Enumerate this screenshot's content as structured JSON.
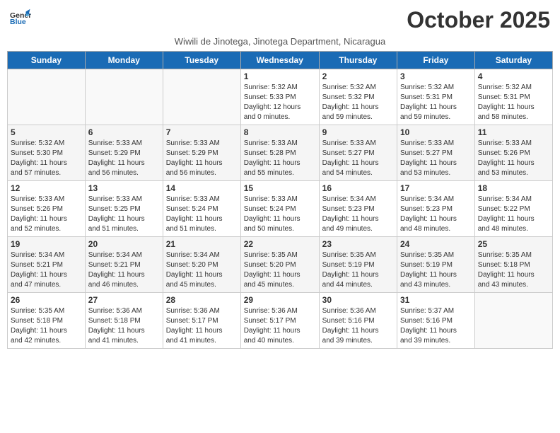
{
  "header": {
    "logo_general": "General",
    "logo_blue": "Blue",
    "month_title": "October 2025",
    "subtitle": "Wiwili de Jinotega, Jinotega Department, Nicaragua"
  },
  "weekdays": [
    "Sunday",
    "Monday",
    "Tuesday",
    "Wednesday",
    "Thursday",
    "Friday",
    "Saturday"
  ],
  "weeks": [
    [
      {
        "day": "",
        "info": ""
      },
      {
        "day": "",
        "info": ""
      },
      {
        "day": "",
        "info": ""
      },
      {
        "day": "1",
        "info": "Sunrise: 5:32 AM\nSunset: 5:33 PM\nDaylight: 12 hours\nand 0 minutes."
      },
      {
        "day": "2",
        "info": "Sunrise: 5:32 AM\nSunset: 5:32 PM\nDaylight: 11 hours\nand 59 minutes."
      },
      {
        "day": "3",
        "info": "Sunrise: 5:32 AM\nSunset: 5:31 PM\nDaylight: 11 hours\nand 59 minutes."
      },
      {
        "day": "4",
        "info": "Sunrise: 5:32 AM\nSunset: 5:31 PM\nDaylight: 11 hours\nand 58 minutes."
      }
    ],
    [
      {
        "day": "5",
        "info": "Sunrise: 5:32 AM\nSunset: 5:30 PM\nDaylight: 11 hours\nand 57 minutes."
      },
      {
        "day": "6",
        "info": "Sunrise: 5:33 AM\nSunset: 5:29 PM\nDaylight: 11 hours\nand 56 minutes."
      },
      {
        "day": "7",
        "info": "Sunrise: 5:33 AM\nSunset: 5:29 PM\nDaylight: 11 hours\nand 56 minutes."
      },
      {
        "day": "8",
        "info": "Sunrise: 5:33 AM\nSunset: 5:28 PM\nDaylight: 11 hours\nand 55 minutes."
      },
      {
        "day": "9",
        "info": "Sunrise: 5:33 AM\nSunset: 5:27 PM\nDaylight: 11 hours\nand 54 minutes."
      },
      {
        "day": "10",
        "info": "Sunrise: 5:33 AM\nSunset: 5:27 PM\nDaylight: 11 hours\nand 53 minutes."
      },
      {
        "day": "11",
        "info": "Sunrise: 5:33 AM\nSunset: 5:26 PM\nDaylight: 11 hours\nand 53 minutes."
      }
    ],
    [
      {
        "day": "12",
        "info": "Sunrise: 5:33 AM\nSunset: 5:26 PM\nDaylight: 11 hours\nand 52 minutes."
      },
      {
        "day": "13",
        "info": "Sunrise: 5:33 AM\nSunset: 5:25 PM\nDaylight: 11 hours\nand 51 minutes."
      },
      {
        "day": "14",
        "info": "Sunrise: 5:33 AM\nSunset: 5:24 PM\nDaylight: 11 hours\nand 51 minutes."
      },
      {
        "day": "15",
        "info": "Sunrise: 5:33 AM\nSunset: 5:24 PM\nDaylight: 11 hours\nand 50 minutes."
      },
      {
        "day": "16",
        "info": "Sunrise: 5:34 AM\nSunset: 5:23 PM\nDaylight: 11 hours\nand 49 minutes."
      },
      {
        "day": "17",
        "info": "Sunrise: 5:34 AM\nSunset: 5:23 PM\nDaylight: 11 hours\nand 48 minutes."
      },
      {
        "day": "18",
        "info": "Sunrise: 5:34 AM\nSunset: 5:22 PM\nDaylight: 11 hours\nand 48 minutes."
      }
    ],
    [
      {
        "day": "19",
        "info": "Sunrise: 5:34 AM\nSunset: 5:21 PM\nDaylight: 11 hours\nand 47 minutes."
      },
      {
        "day": "20",
        "info": "Sunrise: 5:34 AM\nSunset: 5:21 PM\nDaylight: 11 hours\nand 46 minutes."
      },
      {
        "day": "21",
        "info": "Sunrise: 5:34 AM\nSunset: 5:20 PM\nDaylight: 11 hours\nand 45 minutes."
      },
      {
        "day": "22",
        "info": "Sunrise: 5:35 AM\nSunset: 5:20 PM\nDaylight: 11 hours\nand 45 minutes."
      },
      {
        "day": "23",
        "info": "Sunrise: 5:35 AM\nSunset: 5:19 PM\nDaylight: 11 hours\nand 44 minutes."
      },
      {
        "day": "24",
        "info": "Sunrise: 5:35 AM\nSunset: 5:19 PM\nDaylight: 11 hours\nand 43 minutes."
      },
      {
        "day": "25",
        "info": "Sunrise: 5:35 AM\nSunset: 5:18 PM\nDaylight: 11 hours\nand 43 minutes."
      }
    ],
    [
      {
        "day": "26",
        "info": "Sunrise: 5:35 AM\nSunset: 5:18 PM\nDaylight: 11 hours\nand 42 minutes."
      },
      {
        "day": "27",
        "info": "Sunrise: 5:36 AM\nSunset: 5:18 PM\nDaylight: 11 hours\nand 41 minutes."
      },
      {
        "day": "28",
        "info": "Sunrise: 5:36 AM\nSunset: 5:17 PM\nDaylight: 11 hours\nand 41 minutes."
      },
      {
        "day": "29",
        "info": "Sunrise: 5:36 AM\nSunset: 5:17 PM\nDaylight: 11 hours\nand 40 minutes."
      },
      {
        "day": "30",
        "info": "Sunrise: 5:36 AM\nSunset: 5:16 PM\nDaylight: 11 hours\nand 39 minutes."
      },
      {
        "day": "31",
        "info": "Sunrise: 5:37 AM\nSunset: 5:16 PM\nDaylight: 11 hours\nand 39 minutes."
      },
      {
        "day": "",
        "info": ""
      }
    ]
  ]
}
